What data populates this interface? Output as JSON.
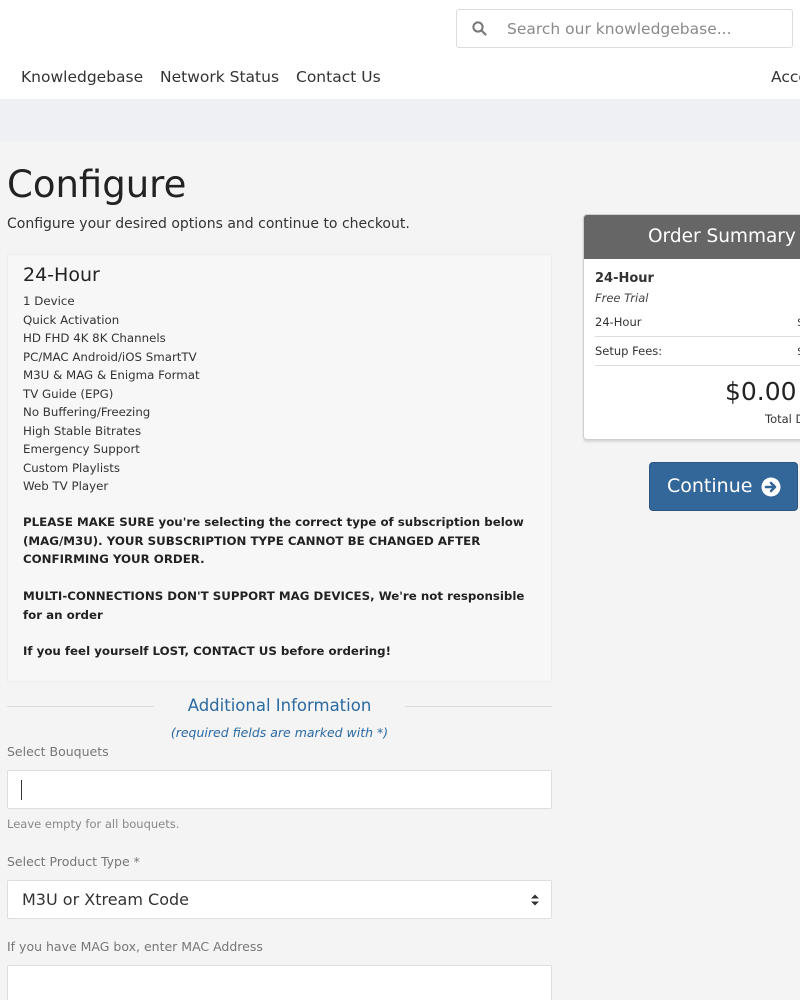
{
  "header": {
    "search": {
      "placeholder": "Search our knowledgebase..."
    },
    "nav": [
      {
        "label": "Knowledgebase"
      },
      {
        "label": "Network Status"
      },
      {
        "label": "Contact Us"
      },
      {
        "label": "Acco"
      }
    ]
  },
  "main": {
    "title": "Configure",
    "subtitle": "Configure your desired options and continue to checkout.",
    "product": {
      "name": "24-Hour",
      "features": [
        "1 Device",
        "Quick Activation",
        "HD FHD 4K 8K Channels",
        "PC/MAC Android/iOS SmartTV",
        "M3U & MAG & Enigma Format",
        "TV Guide (EPG)",
        "No Buffering/Freezing",
        "High Stable Bitrates",
        "Emergency Support",
        "Custom Playlists",
        "Web TV Player"
      ],
      "notices": [
        "PLEASE MAKE SURE you're selecting the correct type of subscription below (MAG/M3U). YOUR SUBSCRIPTION TYPE CANNOT BE CHANGED AFTER CONFIRMING YOUR ORDER.",
        "MULTI-CONNECTIONS DON'T SUPPORT MAG DEVICES, We're not responsible for an order",
        "If you feel yourself LOST, CONTACT US before ordering!"
      ]
    },
    "additional": {
      "title": "Additional Information",
      "required_note": "(required fields are marked with *)",
      "bouquets": {
        "label": "Select Bouquets",
        "value": "",
        "help": "Leave empty for all bouquets."
      },
      "product_type": {
        "label": "Select Product Type *",
        "value": "M3U or Xtream Code"
      },
      "mac": {
        "label": "If you have MAG box, enter MAC Address",
        "value": ""
      }
    }
  },
  "summary": {
    "title": "Order Summary",
    "product": "24-Hour",
    "subtitle": "Free Trial",
    "rows": [
      {
        "label": "24-Hour",
        "value": "$"
      },
      {
        "label": "Setup Fees:",
        "value": "$"
      }
    ],
    "total": "$0.00",
    "total_label": "Total D"
  },
  "continue_label": "Continue",
  "colors": {
    "accent": "#336699",
    "link": "#2b6aa3",
    "summary_header": "#666666"
  }
}
